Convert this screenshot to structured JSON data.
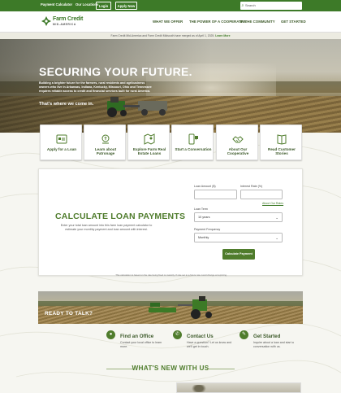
{
  "utility": {
    "payment_calculator": "Payment Calculator",
    "our_locations": "Our Locations",
    "login": "Login",
    "apply_now": "Apply Now",
    "search_placeholder": "Search"
  },
  "header": {
    "logo_text": "Farm Credit",
    "logo_sub": "MID-AMERICA",
    "nav": [
      "WHAT WE OFFER",
      "THE POWER OF A COOPERATIVE",
      "IN THE COMMUNITY",
      "GET STARTED"
    ]
  },
  "notice": {
    "text": "Farm Credit Mid-America and Farm Credit Midsouth have merged as of April 1, 2025. ",
    "link": "Learn More"
  },
  "hero": {
    "title": "SECURING YOUR FUTURE.",
    "body": "Building a brighter future for the farmers, rural residents and agribusiness owners who live in Arkansas, Indiana, Kentucky, Missouri, Ohio and Tennessee requires reliable access to credit and financial services built for rural America.",
    "tagline": "That's where we come in."
  },
  "tiles": [
    {
      "label": "Apply for a Loan",
      "icon": "apply-icon"
    },
    {
      "label": "Learn about Patronage",
      "icon": "patronage-icon"
    },
    {
      "label": "Explore Farm Real Estate Loans",
      "icon": "map-icon"
    },
    {
      "label": "Start a Conversation",
      "icon": "phone-chat-icon"
    },
    {
      "label": "About Our Cooperative",
      "icon": "handshake-icon"
    },
    {
      "label": "Read Customer Stories",
      "icon": "book-icon"
    }
  ],
  "calculator": {
    "title": "CALCULATE LOAN PAYMENTS",
    "description": "Enter your total loan amount into this farm loan payment calculator to estimate your monthly payment and loan amount with interest.",
    "loan_amount_label": "Loan Amount ($)",
    "interest_rate_label": "Interest Rate (%)",
    "about_rates": "About Our Rates",
    "loan_term_label": "Loan Term",
    "loan_term_value": "10 years",
    "payment_frequency_label": "Payment Frequency",
    "payment_frequency_value": "Monthly",
    "button": "Calculate Payment",
    "footnote": "This calculation is based on the rate being fixed to maturity. If rate set to a future rate could change at repricing."
  },
  "talk": {
    "title": "READY TO TALK?"
  },
  "contact": [
    {
      "title": "Find an Office",
      "desc": "Contact your local office to learn more.",
      "icon": "location-icon"
    },
    {
      "title": "Contact Us",
      "desc": "Have a question? Let us know and we'll get in touch.",
      "icon": "phone-icon"
    },
    {
      "title": "Get Started",
      "desc": "Inquire about a loan and start a conversation with us.",
      "icon": "chat-icon"
    }
  ],
  "news": {
    "title": "WHAT'S NEW WITH US"
  },
  "colors": {
    "brand_green": "#3d7a28",
    "accent_green": "#4f7c2c"
  }
}
